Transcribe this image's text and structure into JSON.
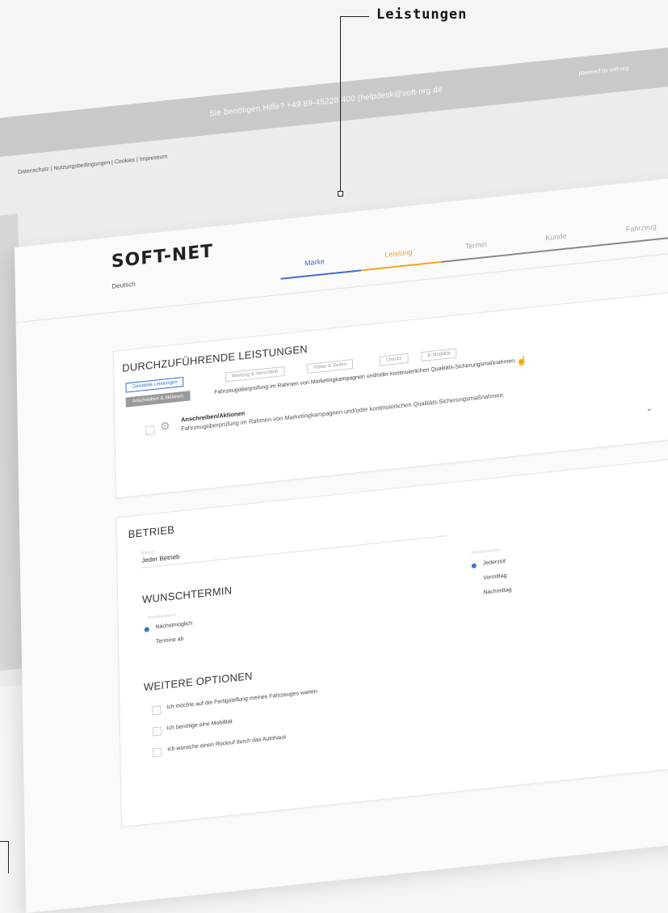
{
  "callout": {
    "label": "Leistungen"
  },
  "help": {
    "text": "Sie benötigen Hilfe?   +49 89-45228-400 (helpdesk@soft-nrg.de",
    "powered": "powered by soft-nrg"
  },
  "footer": {
    "links": "Datenschutz | Nutzungsbedingungen | Cookies | Impressum"
  },
  "brand": {
    "logo": "SOFT-NET",
    "language": "Deutsch"
  },
  "steps": [
    {
      "label": "Marke",
      "state": "done"
    },
    {
      "label": "Leistung",
      "state": "active"
    },
    {
      "label": "Termin",
      "state": "pending"
    },
    {
      "label": "Kunde",
      "state": "pending"
    },
    {
      "label": "Fahrzeug",
      "state": "pending"
    }
  ],
  "colors": {
    "blue": "#3b6fd4",
    "orange": "#f2a51f",
    "gray": "#999999"
  },
  "services": {
    "title": "DURCHZUFÜHRENDE LEISTUNGEN",
    "chips": [
      "Gewählte Leistungen",
      "Wartung & Verschleiß",
      "Räder & Reifen",
      "Checks",
      "E-Mobilität"
    ],
    "active_chip": "Anschreiben & Aktionen",
    "info": "Fahrzeugüberprüfung im Rahmen von Marketingkampagnen und/oder kontinuierlichen Qualitäts-Sicherungsmaßnahmen.",
    "item_title": "Anschreiben/Aktionen",
    "item_desc": "Fahrzeugüberprüfung im Rahmen von Marketingkampagnen und/oder kontinuierlichen Qualitäts-Sicherungsmaßnahmen."
  },
  "betrieb": {
    "title": "BETRIEB",
    "label": "Betrieb",
    "value": "Jeder Betrieb"
  },
  "wunschtermin": {
    "title": "WUNSCHTERMIN",
    "label": "Annahmedatum",
    "options": [
      "Nächstmöglich",
      "Termine ab"
    ],
    "time_label": "Annahmeuhrzeit",
    "time_options": [
      "Jederzeit",
      "Vormittag",
      "Nachmittag"
    ]
  },
  "optionen": {
    "title": "WEITERE OPTIONEN",
    "items": [
      "Ich möchte auf die Fertigstellung meines Fahrzeuges warten",
      "Ich benötige eine Mobilität",
      "Ich wünsche einen Rückruf durch das Autohaus"
    ]
  }
}
